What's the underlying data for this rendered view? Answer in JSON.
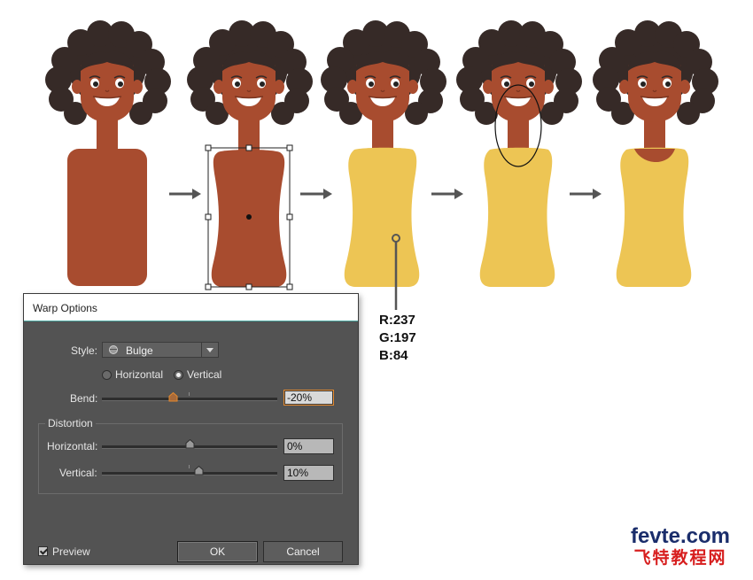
{
  "color_readout": {
    "r": "R:237",
    "g": "G:197",
    "b": "B:84"
  },
  "colors": {
    "skin": "#a84c2f",
    "dress": "#edc554",
    "hair": "#362a27",
    "dialog_bg": "#535353",
    "accent": "#e58a2e"
  },
  "dialog": {
    "title": "Warp Options",
    "style_label": "Style:",
    "style_value": "Bulge",
    "style_icon": "bulge-icon",
    "orientation": {
      "horizontal_label": "Horizontal",
      "vertical_label": "Vertical",
      "selected": "Vertical"
    },
    "bend_label": "Bend:",
    "bend_value": "-20%",
    "distortion": {
      "group_label": "Distortion",
      "horizontal_label": "Horizontal:",
      "horizontal_value": "0%",
      "vertical_label": "Vertical:",
      "vertical_value": "10%"
    },
    "preview_label": "Preview",
    "preview_checked": true,
    "ok_label": "OK",
    "cancel_label": "Cancel"
  },
  "watermark": {
    "domain": "fevte.com",
    "chinese": "飞特教程网"
  }
}
